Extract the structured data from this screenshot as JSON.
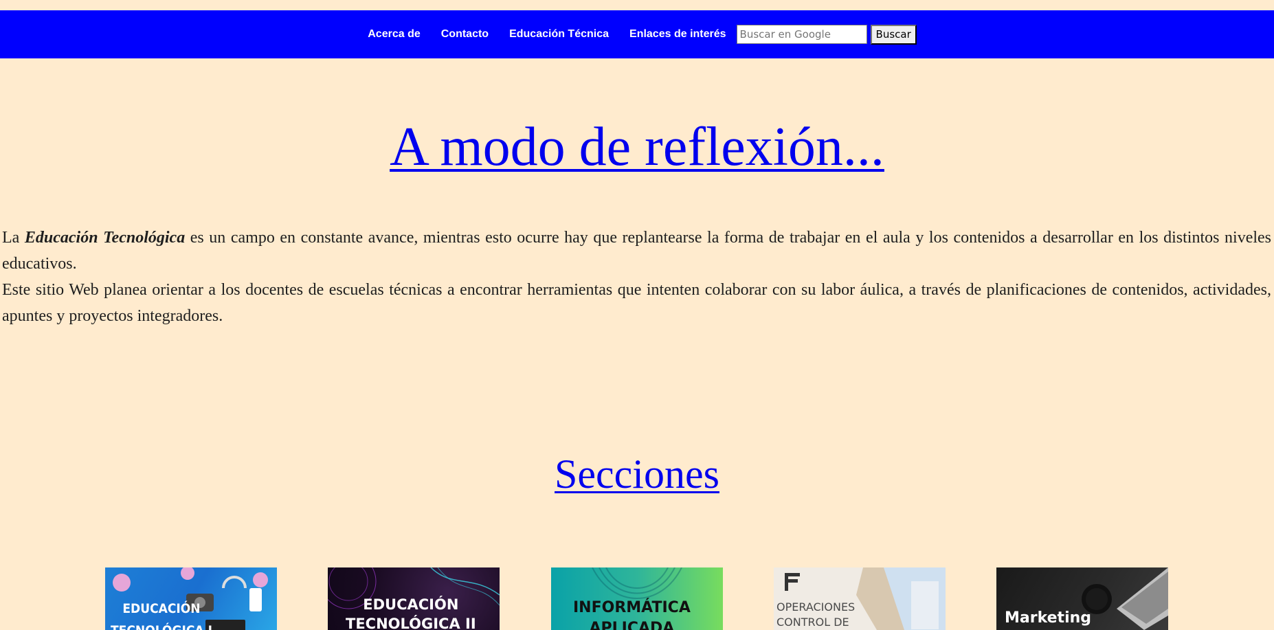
{
  "nav": {
    "links": [
      "Acerca de",
      "Contacto",
      "Educación Técnica",
      "Enlaces de interés"
    ],
    "search_placeholder": "Buscar en Google",
    "search_button": "Buscar"
  },
  "hero": {
    "title": "A modo de reflexión..."
  },
  "intro": {
    "p1_prefix": "La ",
    "p1_strong": "Educación Tecnológica",
    "p1_rest": " es un campo en constante avance, mientras esto ocurre hay que replantearse la forma de trabajar en el aula y los contenidos a desarrollar en los distintos niveles educativos.",
    "p2": "Este sitio Web planea orientar a los docentes de escuelas técnicas a encontrar herramientas que intenten colaborar con su labor áulica, a través de planificaciones de contenidos, actividades, apuntes y proyectos integradores."
  },
  "sections": {
    "title": "Secciones",
    "cards": [
      {
        "label": "EDUCACIÓN\nTECNOLÓGICA I",
        "color": "#1e7fd6"
      },
      {
        "label": "EDUCACIÓN\nTECNOLÓGICA II",
        "color": "#1a0b22"
      },
      {
        "label": "INFORMÁTICA\nAPLICADA",
        "color": "#2fb59a"
      },
      {
        "label": "OPERACIONES\nCONTROL DE",
        "color": "#f0ebe4"
      },
      {
        "label": "Marketing",
        "color": "#1a1a1a"
      }
    ]
  },
  "colors": {
    "background": "#ffebce",
    "navbar": "#0000fe",
    "link": "#0000ee"
  }
}
